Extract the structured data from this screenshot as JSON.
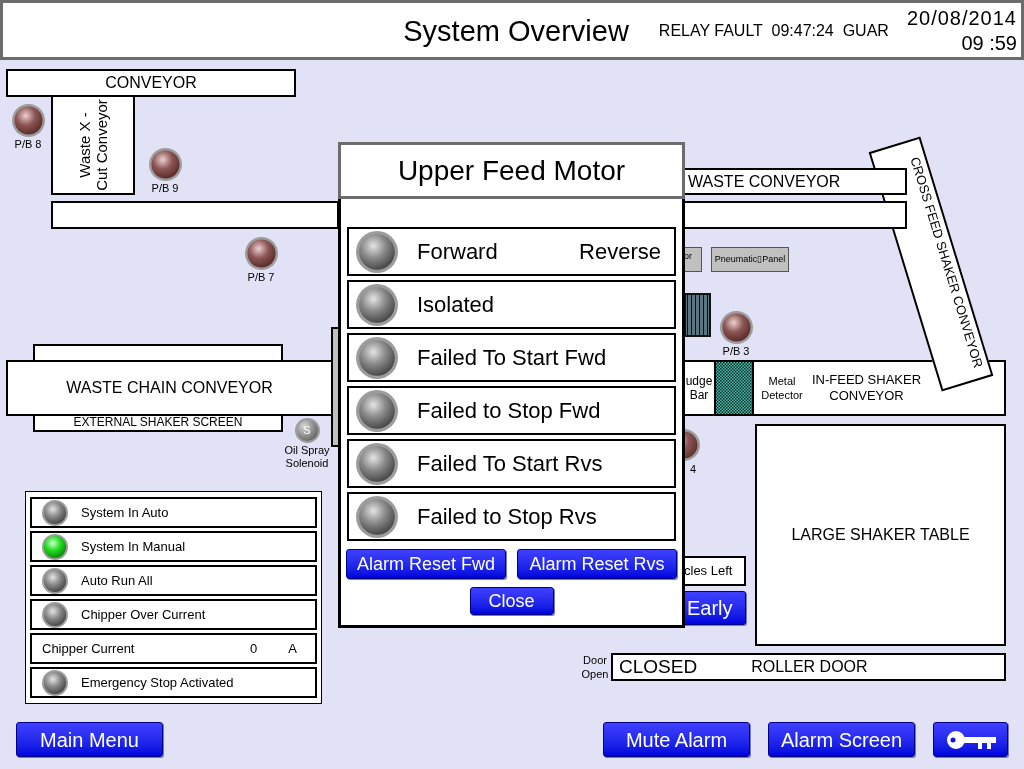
{
  "header": {
    "title": "System Overview",
    "alarm_ticker": "RELAY FAULT  09:47:24  GUAR",
    "date": "20/08/2014",
    "time": "09 :59"
  },
  "plant": {
    "conveyor": "CONVEYOR",
    "cut_conveyor": "Waste X -\nCut Conveyor",
    "push_buttons": [
      {
        "label": "P/B 8"
      },
      {
        "label": "P/B 9"
      },
      {
        "label": "P/B 7"
      },
      {
        "label": "P/B 3"
      }
    ],
    "partial_push_button": {
      "label": "4"
    },
    "waste_conveyor": "WASTE CONVEYOR",
    "panels": [
      "or",
      "Pneumatic▯Panel"
    ],
    "cross_feed_conveyor": "CROSS FEED SHAKER CONVEYOR",
    "waste_chain_conveyor": "WASTE CHAIN CONVEYOR",
    "shaker_screen": "EXTERNAL SHAKER SCREEN",
    "oil_spray_solenoid": {
      "symbol": "S",
      "label": "Oil Spray\nSolenoid"
    },
    "in_feed": {
      "nudge_bar": "udge\nBar",
      "metal_detector": "Metal\nDetector",
      "name": "IN-FEED SHAKER\nCONVEYOR"
    },
    "shaker_table": "LARGE SHAKER TABLE",
    "cycles_left": "cles Left",
    "early_button": "Early",
    "roller_door": {
      "door_label": "Door\nOpen",
      "state": "CLOSED",
      "name": "ROLLER DOOR"
    }
  },
  "status_panel": {
    "rows": [
      {
        "kind": "lamp",
        "label": "System In Auto",
        "on": false
      },
      {
        "kind": "lamp",
        "label": "System In Manual",
        "on": true
      },
      {
        "kind": "lamp",
        "label": "Auto Run All",
        "on": false
      },
      {
        "kind": "lamp",
        "label": "Chipper Over Current",
        "on": false
      },
      {
        "kind": "reading",
        "label": "Chipper Current",
        "value": "0",
        "unit": "A"
      },
      {
        "kind": "lamp",
        "label": "Emergency Stop Activated",
        "on": false
      }
    ]
  },
  "popup": {
    "title": "Upper Feed Motor",
    "rows": [
      {
        "label": "Forward",
        "label_right": "Reverse",
        "on": false
      },
      {
        "label": "Isolated",
        "on": false
      },
      {
        "label": "Failed To Start Fwd",
        "on": false
      },
      {
        "label": "Failed to Stop Fwd",
        "on": false
      },
      {
        "label": "Failed To Start Rvs",
        "on": false
      },
      {
        "label": "Failed to Stop Rvs",
        "on": false
      }
    ],
    "buttons": [
      "Alarm Reset Fwd",
      "Alarm Reset Rvs"
    ],
    "close_button": "Close"
  },
  "footer": {
    "left_buttons": [
      "Main Menu"
    ],
    "right_buttons": [
      "Mute Alarm",
      "Alarm Screen"
    ]
  }
}
